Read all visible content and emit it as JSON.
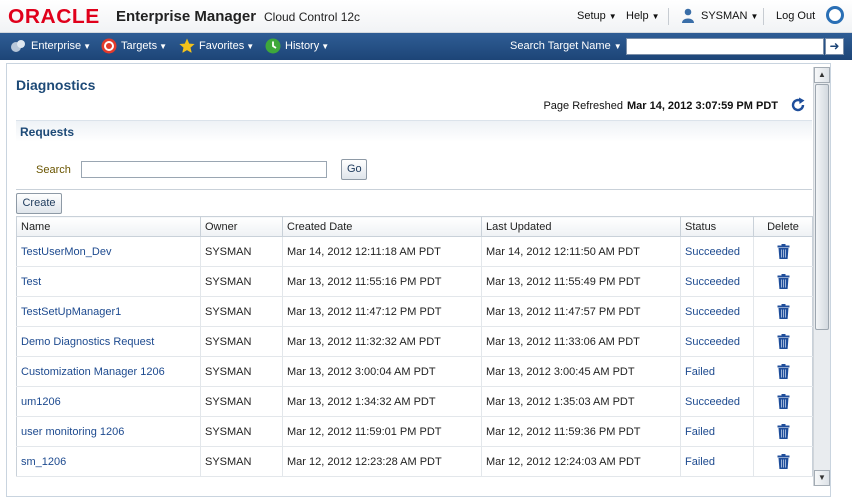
{
  "brand": {
    "logo": "ORACLE",
    "product": "Enterprise Manager",
    "edition": "Cloud Control 12c"
  },
  "topnav": {
    "setup": "Setup",
    "help": "Help",
    "user": "SYSMAN",
    "logout": "Log Out"
  },
  "nav": {
    "enterprise": "Enterprise",
    "targets": "Targets",
    "favorites": "Favorites",
    "history": "History",
    "search_label": "Search Target Name",
    "search_value": ""
  },
  "page": {
    "title": "Diagnostics",
    "refresh_label": "Page Refreshed",
    "refresh_time": "Mar 14, 2012 3:07:59 PM PDT"
  },
  "requests": {
    "section_title": "Requests",
    "search_label": "Search",
    "search_value": "",
    "go_label": "Go",
    "create_label": "Create",
    "columns": [
      "Name",
      "Owner",
      "Created Date",
      "Last Updated",
      "Status",
      "Delete"
    ],
    "rows": [
      {
        "name": "TestUserMon_Dev",
        "owner": "SYSMAN",
        "created": "Mar 14, 2012 12:11:18 AM PDT",
        "updated": "Mar 14, 2012 12:11:50 AM PDT",
        "status": "Succeeded"
      },
      {
        "name": "Test",
        "owner": "SYSMAN",
        "created": "Mar 13, 2012 11:55:16 PM PDT",
        "updated": "Mar 13, 2012 11:55:49 PM PDT",
        "status": "Succeeded"
      },
      {
        "name": "TestSetUpManager1",
        "owner": "SYSMAN",
        "created": "Mar 13, 2012 11:47:12 PM PDT",
        "updated": "Mar 13, 2012 11:47:57 PM PDT",
        "status": "Succeeded"
      },
      {
        "name": "Demo Diagnostics Request",
        "owner": "SYSMAN",
        "created": "Mar 13, 2012 11:32:32 AM PDT",
        "updated": "Mar 13, 2012 11:33:06 AM PDT",
        "status": "Succeeded"
      },
      {
        "name": "Customization Manager 1206",
        "owner": "SYSMAN",
        "created": "Mar 13, 2012 3:00:04 AM PDT",
        "updated": "Mar 13, 2012 3:00:45 AM PDT",
        "status": "Failed"
      },
      {
        "name": "um1206",
        "owner": "SYSMAN",
        "created": "Mar 13, 2012 1:34:32 AM PDT",
        "updated": "Mar 13, 2012 1:35:03 AM PDT",
        "status": "Succeeded"
      },
      {
        "name": "user monitoring 1206",
        "owner": "SYSMAN",
        "created": "Mar 12, 2012 11:59:01 PM PDT",
        "updated": "Mar 12, 2012 11:59:36 PM PDT",
        "status": "Failed"
      },
      {
        "name": "sm_1206",
        "owner": "SYSMAN",
        "created": "Mar 12, 2012 12:23:28 AM PDT",
        "updated": "Mar 12, 2012 12:24:03 AM PDT",
        "status": "Failed"
      }
    ]
  },
  "icons": {
    "enterprise": "enterprise-icon",
    "targets": "targets-icon",
    "favorites": "star-icon",
    "history": "history-icon",
    "delete": "trash-icon",
    "refresh": "refresh-icon"
  },
  "colors": {
    "brand_red": "#e0001b",
    "nav_blue": "#1d4577",
    "link_blue": "#1d4a8f",
    "trash_blue": "#1f4e9b"
  }
}
